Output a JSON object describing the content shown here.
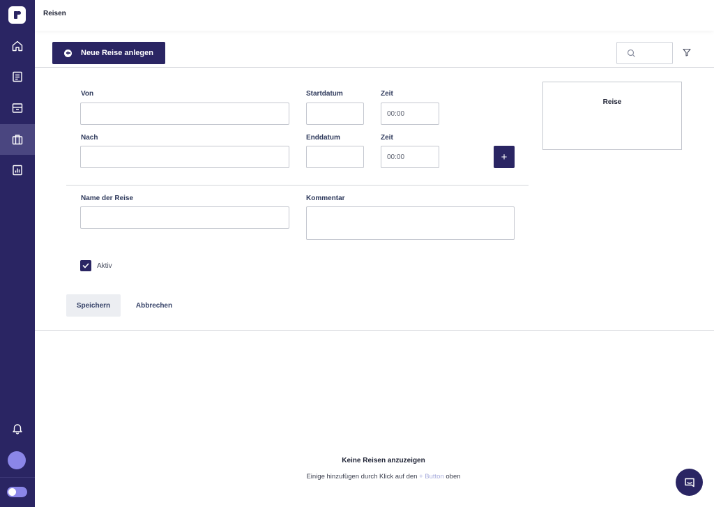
{
  "header": {
    "title": "Reisen"
  },
  "toolbar": {
    "new_trip_label": "Neue Reise anlegen",
    "search_value": ""
  },
  "form": {
    "from": {
      "label": "Von",
      "value": ""
    },
    "start_date": {
      "label": "Startdatum",
      "value": ""
    },
    "start_time": {
      "label": "Zeit",
      "value": "00:00"
    },
    "to": {
      "label": "Nach",
      "value": ""
    },
    "end_date": {
      "label": "Enddatum",
      "value": ""
    },
    "end_time": {
      "label": "Zeit",
      "value": "00:00"
    },
    "add_stop_label": "+",
    "trip_name": {
      "label": "Name der Reise",
      "value": ""
    },
    "comment": {
      "label": "Kommentar",
      "value": ""
    },
    "active": {
      "label": "Aktiv",
      "checked": true
    },
    "save_label": "Speichern",
    "cancel_label": "Abbrechen"
  },
  "preview_card": {
    "title": "Reise"
  },
  "empty_state": {
    "title": "Keine Reisen anzuzeigen",
    "text_before": "Einige hinzufügen durch Klick auf den",
    "link": "+ Button",
    "text_after": "oben"
  },
  "sidebar": {
    "items": [
      {
        "icon": "home-icon",
        "active": false
      },
      {
        "icon": "document-icon",
        "active": false
      },
      {
        "icon": "inbox-icon",
        "active": false
      },
      {
        "icon": "briefcase-icon",
        "active": true
      },
      {
        "icon": "report-icon",
        "active": false
      }
    ],
    "bottom": [
      "bell-icon",
      "avatar",
      "theme-toggle"
    ]
  },
  "colors": {
    "sidebar": "#2a2563",
    "primary": "#2a2563",
    "sidebar_active": "#4a4680",
    "avatar": "#8b86e8",
    "link": "#a7acdc"
  }
}
